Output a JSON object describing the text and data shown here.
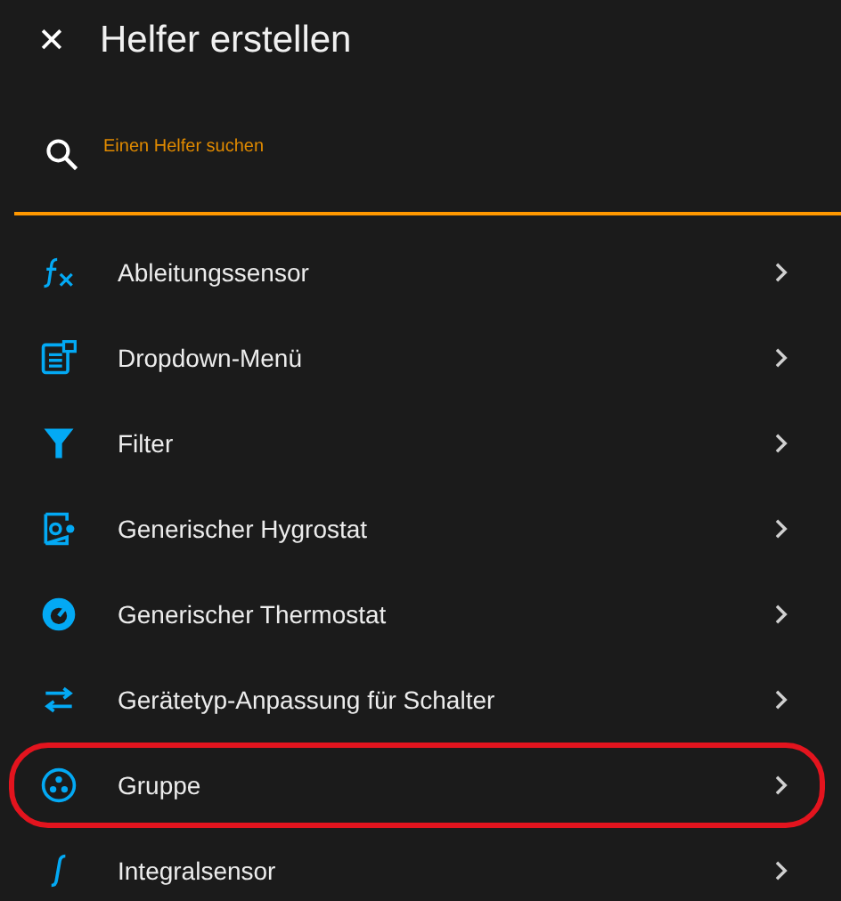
{
  "header": {
    "close": "✕",
    "title": "Helfer erstellen"
  },
  "search": {
    "placeholder": "Einen Helfer suchen"
  },
  "items": [
    {
      "kind": "derivative",
      "label": "Ableitungssensor",
      "highlighted": false
    },
    {
      "kind": "dropdown",
      "label": "Dropdown-Menü",
      "highlighted": false
    },
    {
      "kind": "filter",
      "label": "Filter",
      "highlighted": false
    },
    {
      "kind": "hygrostat",
      "label": "Generischer Hygrostat",
      "highlighted": false
    },
    {
      "kind": "thermostat",
      "label": "Generischer Thermostat",
      "highlighted": false
    },
    {
      "kind": "switch_as_x",
      "label": "Gerätetyp-Anpassung für Schalter",
      "highlighted": false
    },
    {
      "kind": "group",
      "label": "Gruppe",
      "highlighted": true
    },
    {
      "kind": "integral",
      "label": "Integralsensor",
      "highlighted": false
    }
  ]
}
